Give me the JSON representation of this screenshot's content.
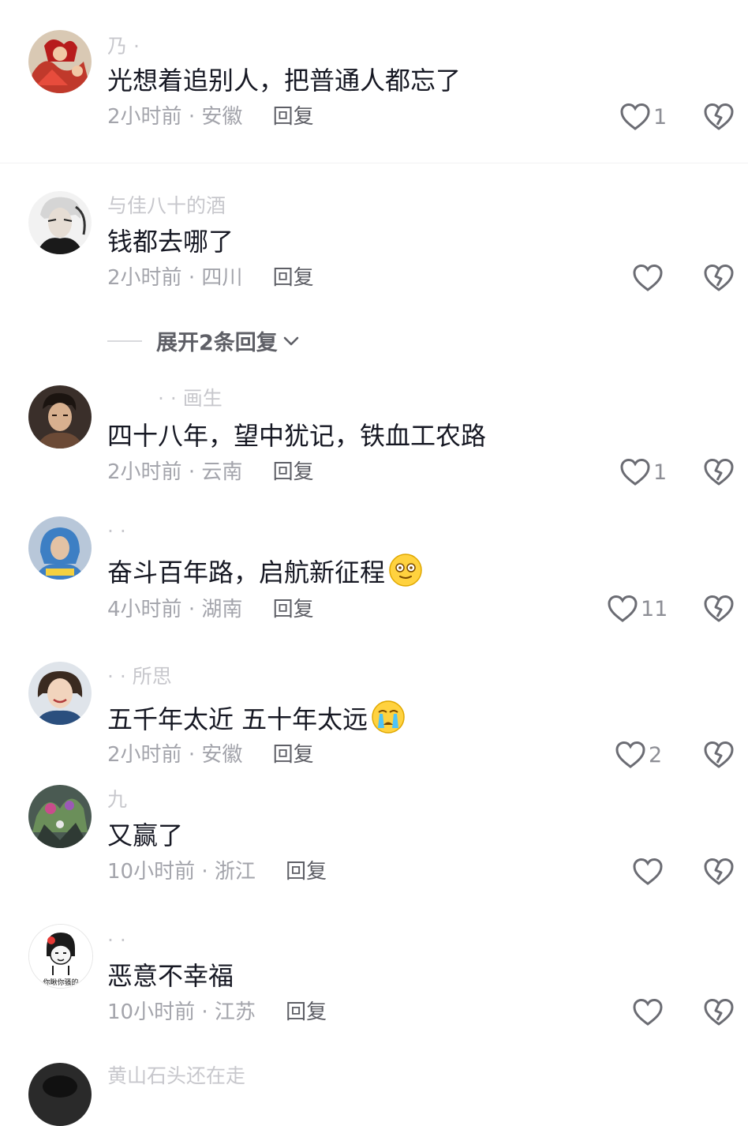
{
  "comments": [
    {
      "username": "乃 ·",
      "text": "光想着追别人，把普通人都忘了",
      "time": "2小时前",
      "location": "安徽",
      "reply_label": "回复",
      "likes": "1",
      "emoji": ""
    },
    {
      "username": "与佳八十的酒",
      "text": "钱都去哪了",
      "time": "2小时前",
      "location": "四川",
      "reply_label": "回复",
      "likes": "",
      "emoji": ""
    },
    {
      "username": "· · 画生",
      "text": "四十八年，望中犹记，铁血工农路",
      "time": "2小时前",
      "location": "云南",
      "reply_label": "回复",
      "likes": "1",
      "emoji": ""
    },
    {
      "username": "· ·",
      "text": "奋斗百年路，启航新征程",
      "time": "4小时前",
      "location": "湖南",
      "reply_label": "回复",
      "likes": "11",
      "emoji": "dizzy-face-emoji"
    },
    {
      "username": "· · 所思",
      "text": "五千年太近 五十年太远",
      "time": "2小时前",
      "location": "安徽",
      "reply_label": "回复",
      "likes": "2",
      "emoji": "crying-face-emoji"
    },
    {
      "username": "九",
      "text": "又赢了",
      "time": "10小时前",
      "location": "浙江",
      "reply_label": "回复",
      "likes": "",
      "emoji": ""
    },
    {
      "username": "· ·",
      "text": "恶意不幸福",
      "time": "10小时前",
      "location": "江苏",
      "reply_label": "回复",
      "likes": "",
      "emoji": ""
    },
    {
      "username": "黄山石头还在走",
      "text": "",
      "time": "",
      "location": "",
      "reply_label": "",
      "likes": "",
      "emoji": ""
    }
  ],
  "expand_replies": {
    "label": "展开2条回复"
  },
  "avatar_texts": {
    "sticker_caption": "你瞅你骚的"
  },
  "separator": "·",
  "icons": {
    "like": "heart-outline-icon",
    "dislike": "broken-heart-icon",
    "expand": "chevron-down-icon"
  },
  "colors": {
    "text": "#161823",
    "meta": "#a3a4ab",
    "reply": "#5e5f66",
    "icon": "#6b6c73"
  }
}
